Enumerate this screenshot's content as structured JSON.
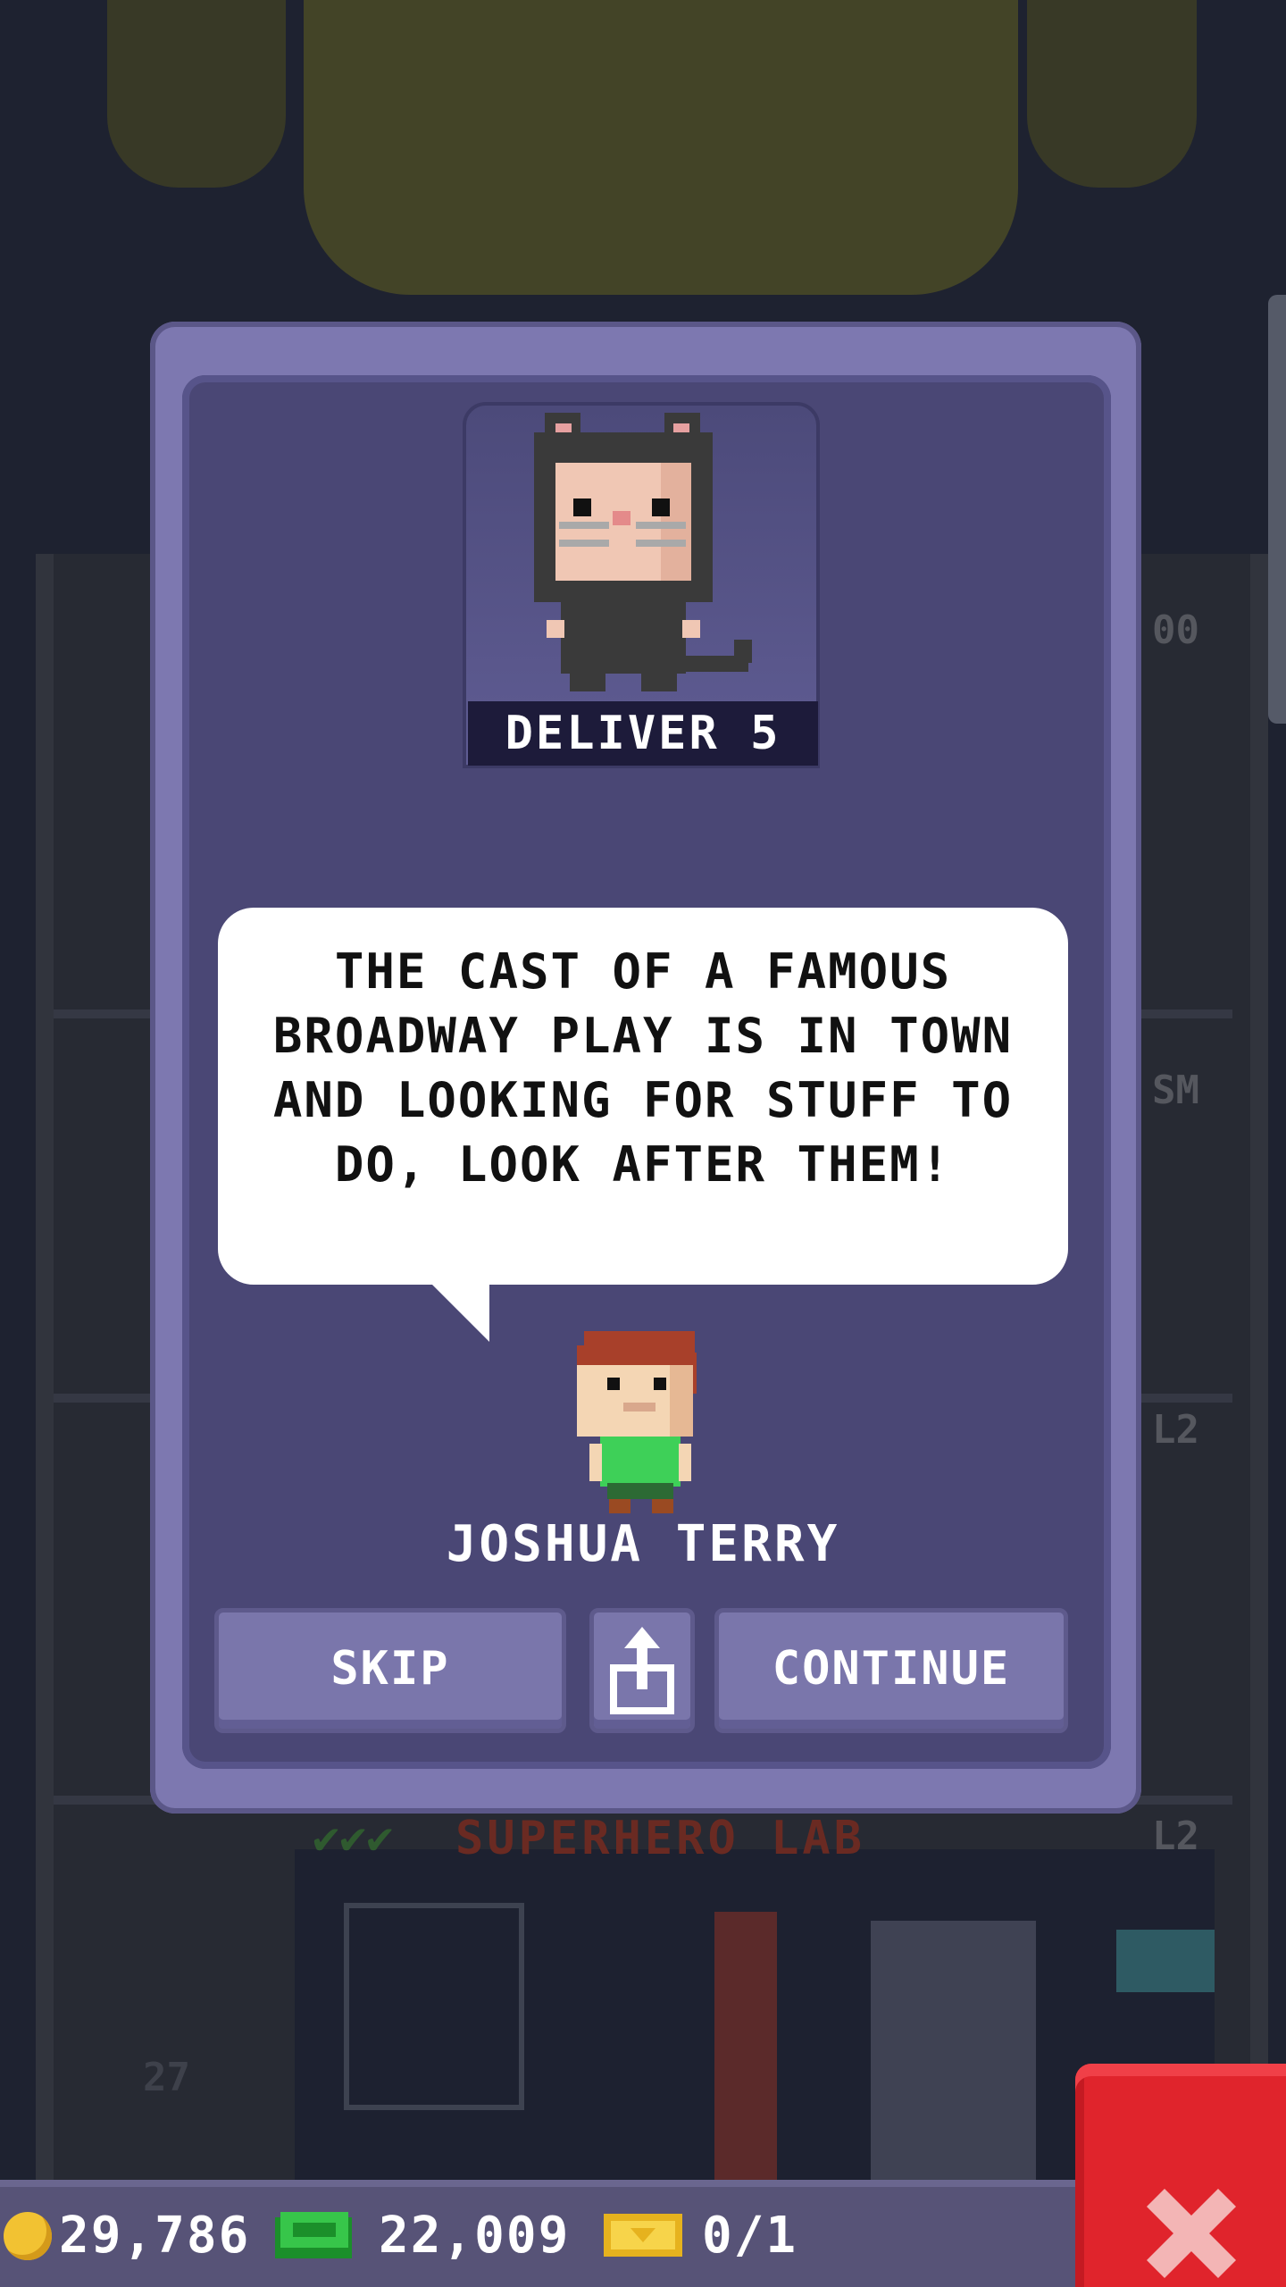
{
  "dialog": {
    "portrait_icon": "cat-costume-bitizen-icon",
    "deliver_label": "DELIVER 5",
    "message": "THE CAST OF A FAMOUS BROADWAY PLAY IS IN TOWN AND LOOKING FOR STUFF TO DO, LOOK AFTER THEM!",
    "customer_name": "JOSHUA TERRY",
    "customer_icon": "bitizen-avatar-icon",
    "skip_label": "SKIP",
    "share_icon": "share-icon",
    "continue_label": "CONTINUE"
  },
  "background": {
    "floor_name": "SUPERHERO LAB",
    "floor_level": "L2",
    "labels": [
      "00",
      "SM",
      "L2"
    ],
    "floor_number": "27"
  },
  "status_bar": {
    "coins": "29,786",
    "coins_icon": "coin-icon",
    "bux": "22,009",
    "bux_icon": "cash-icon",
    "tickets": "0/1",
    "tickets_icon": "golden-ticket-icon",
    "close_icon": "close-icon"
  },
  "colors": {
    "dialog_frame": "#7d78b0",
    "dialog_inner": "#4a4775",
    "button": "#7a76ab",
    "close_button": "#e0242c",
    "deliver_bar": "#1d1b3a"
  }
}
